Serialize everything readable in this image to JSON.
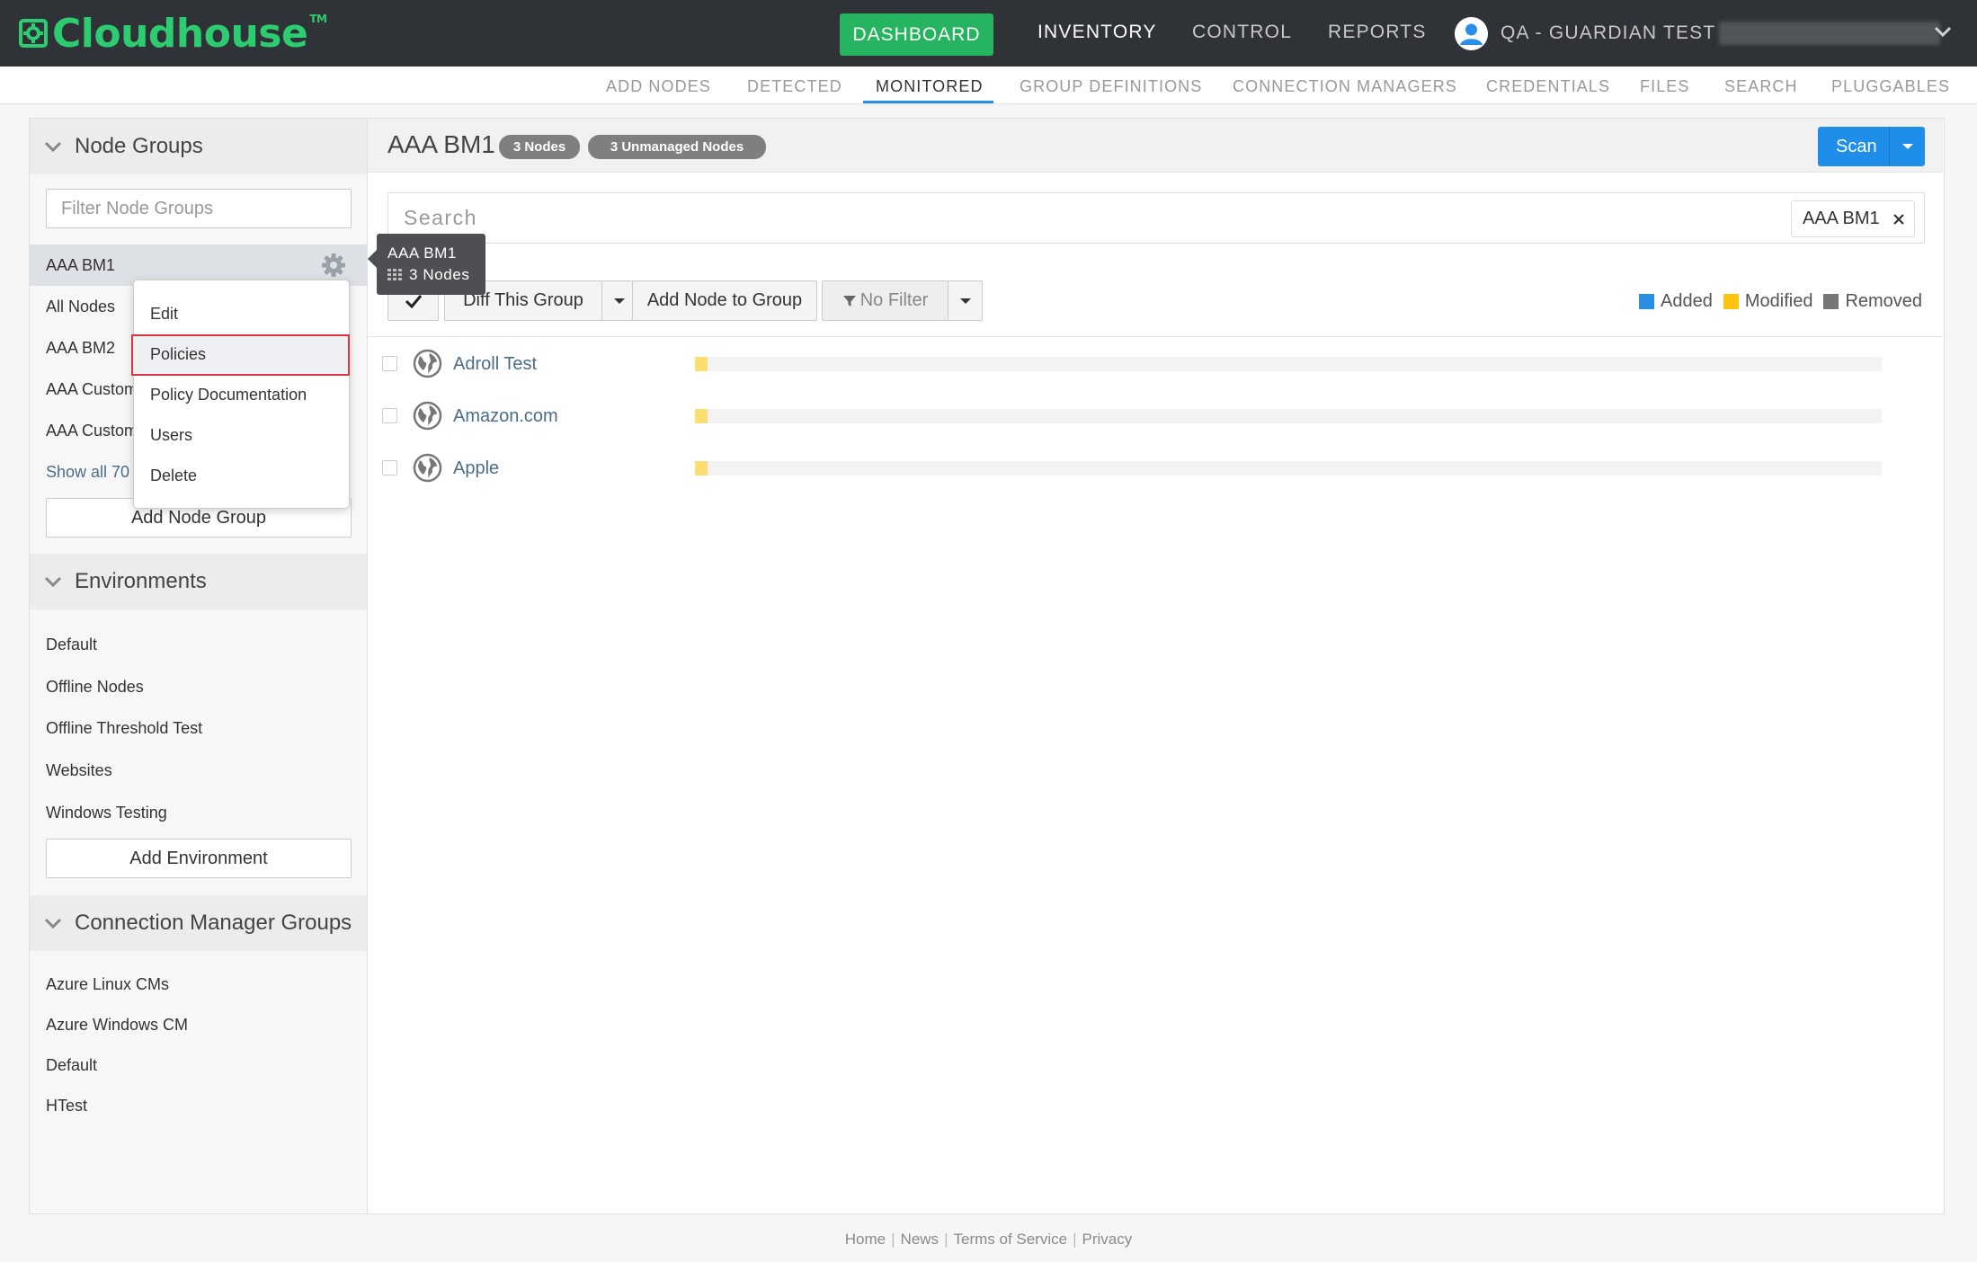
{
  "brand": {
    "name": "Cloudhouse",
    "tm": "TM",
    "color": "#2ecc71"
  },
  "topnav": {
    "dashboard": "DASHBOARD",
    "inventory": "INVENTORY",
    "control": "CONTROL",
    "reports": "REPORTS",
    "user": "QA - GUARDIAN TEST"
  },
  "subnav": {
    "items": [
      "ADD NODES",
      "DETECTED",
      "MONITORED",
      "GROUP DEFINITIONS",
      "CONNECTION MANAGERS",
      "CREDENTIALS",
      "FILES",
      "SEARCH",
      "PLUGGABLES"
    ],
    "active": "MONITORED"
  },
  "sidebar": {
    "node_groups": {
      "title": "Node Groups",
      "filter_placeholder": "Filter Node Groups",
      "items": [
        "AAA BM1",
        "All Nodes",
        "AAA BM2",
        "AAA Custom",
        "AAA Custom"
      ],
      "show_all": "Show all 70",
      "add_button": "Add Node Group"
    },
    "environments": {
      "title": "Environments",
      "items": [
        "Default",
        "Offline Nodes",
        "Offline Threshold Test",
        "Websites",
        "Windows Testing"
      ],
      "add_button": "Add Environment"
    },
    "cm_groups": {
      "title": "Connection Manager Groups",
      "items": [
        "Azure Linux CMs",
        "Azure Windows CM",
        "Default",
        "HTest"
      ]
    }
  },
  "context_menu": {
    "items": [
      "Edit",
      "Policies",
      "Policy Documentation",
      "Users",
      "Delete"
    ],
    "highlighted": "Policies"
  },
  "tooltip": {
    "title": "AAA BM1",
    "count": "3 Nodes"
  },
  "main": {
    "title": "AAA BM1",
    "badges": [
      "3 Nodes",
      "3 Unmanaged Nodes"
    ],
    "scan_label": "Scan",
    "search_placeholder": "Search",
    "search_tag": "AAA BM1",
    "toolbar": {
      "diff": "Diff This Group",
      "add_node": "Add Node to Group",
      "filter": "No Filter"
    },
    "legend": [
      {
        "label": "Added",
        "color": "#2b8ee6"
      },
      {
        "label": "Modified",
        "color": "#ffc40d"
      },
      {
        "label": "Removed",
        "color": "#777777"
      }
    ],
    "nodes": [
      "Adroll Test",
      "Amazon.com",
      "Apple"
    ]
  },
  "footer": [
    "Home",
    "News",
    "Terms of Service",
    "Privacy"
  ]
}
